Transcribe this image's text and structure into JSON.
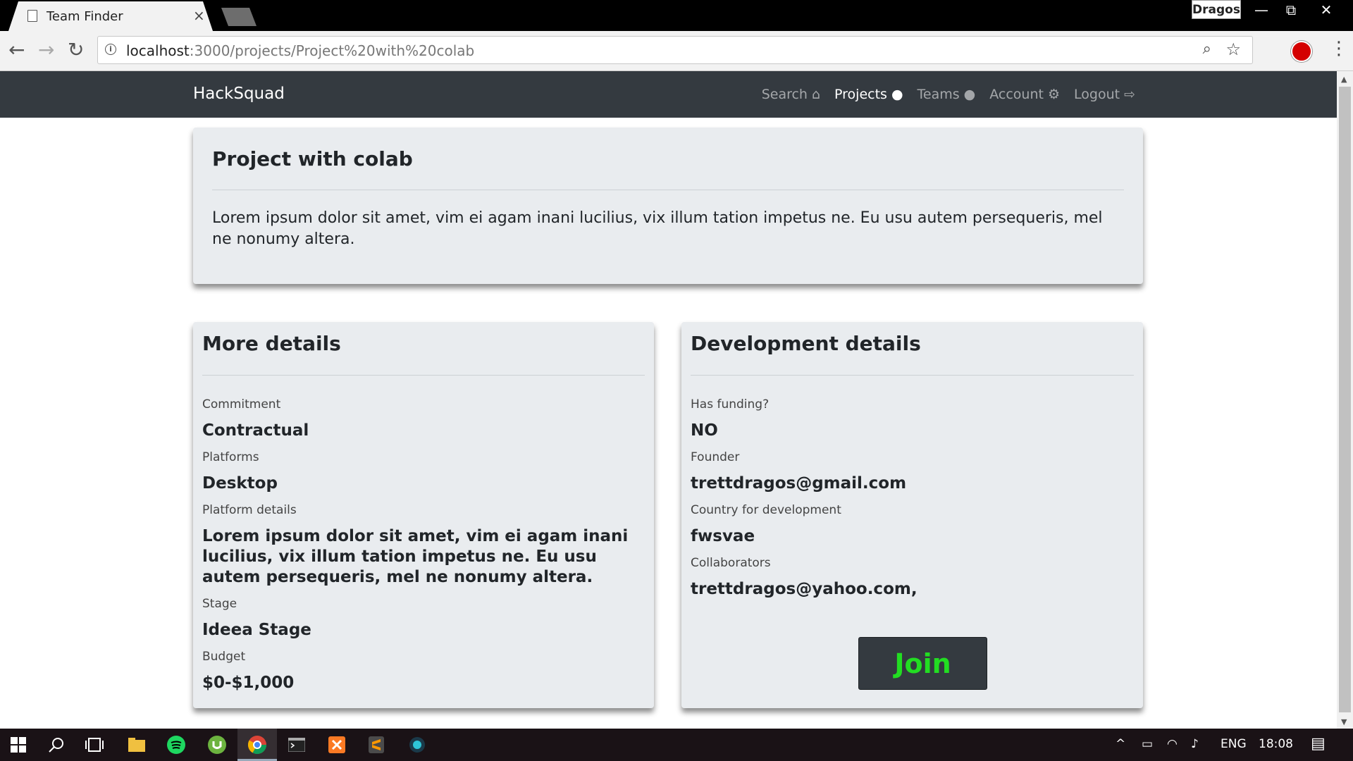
{
  "browser": {
    "tab_title": "Team Finder",
    "tab_close": "×",
    "profile_name": "Dragos",
    "window_controls": {
      "minimize": "—",
      "restore": "⧉",
      "close": "✕"
    },
    "url_host": "localhost",
    "url_path": ":3000/projects/Project%20with%20colab",
    "back_icon": "←",
    "forward_icon": "→",
    "reload_icon": "↻",
    "info_icon": "i",
    "zoom_icon": "⌕",
    "star_icon": "☆",
    "menu_icon": "⋮"
  },
  "navbar": {
    "brand": "HackSquad",
    "links": [
      {
        "label": "Search",
        "icon": "⌂",
        "active": false
      },
      {
        "label": "Projects",
        "icon": "●",
        "active": true
      },
      {
        "label": "Teams",
        "icon": "●",
        "active": false
      },
      {
        "label": "Account",
        "icon": "⚙",
        "active": false
      },
      {
        "label": "Logout",
        "icon": "⇨",
        "active": false
      }
    ]
  },
  "project": {
    "title": "Project with colab",
    "description": "Lorem ipsum dolor sit amet, vim ei agam inani lucilius, vix illum tation impetus ne. Eu usu autem persequeris, mel ne nonumy altera."
  },
  "more_details": {
    "heading": "More details",
    "fields": [
      {
        "label": "Commitment",
        "value": "Contractual"
      },
      {
        "label": "Platforms",
        "value": "Desktop"
      },
      {
        "label": "Platform details",
        "value": "Lorem ipsum dolor sit amet, vim ei agam inani lucilius, vix illum tation impetus ne. Eu usu autem persequeris, mel ne nonumy altera."
      },
      {
        "label": "Stage",
        "value": "Ideea Stage"
      },
      {
        "label": "Budget",
        "value": "$0-$1,000"
      }
    ]
  },
  "development_details": {
    "heading": "Development details",
    "fields": [
      {
        "label": "Has funding?",
        "value": "NO"
      },
      {
        "label": "Founder",
        "value": "trettdragos@gmail.com"
      },
      {
        "label": "Country for development",
        "value": "fwsvae"
      },
      {
        "label": "Collaborators",
        "value": "trettdragos@yahoo.com,"
      }
    ],
    "join_label": "Join"
  },
  "taskbar": {
    "language": "ENG",
    "time": "18:08"
  },
  "colors": {
    "navbar_bg": "#343a40",
    "card_bg": "#e9ecef",
    "join_text": "#22dd22"
  }
}
